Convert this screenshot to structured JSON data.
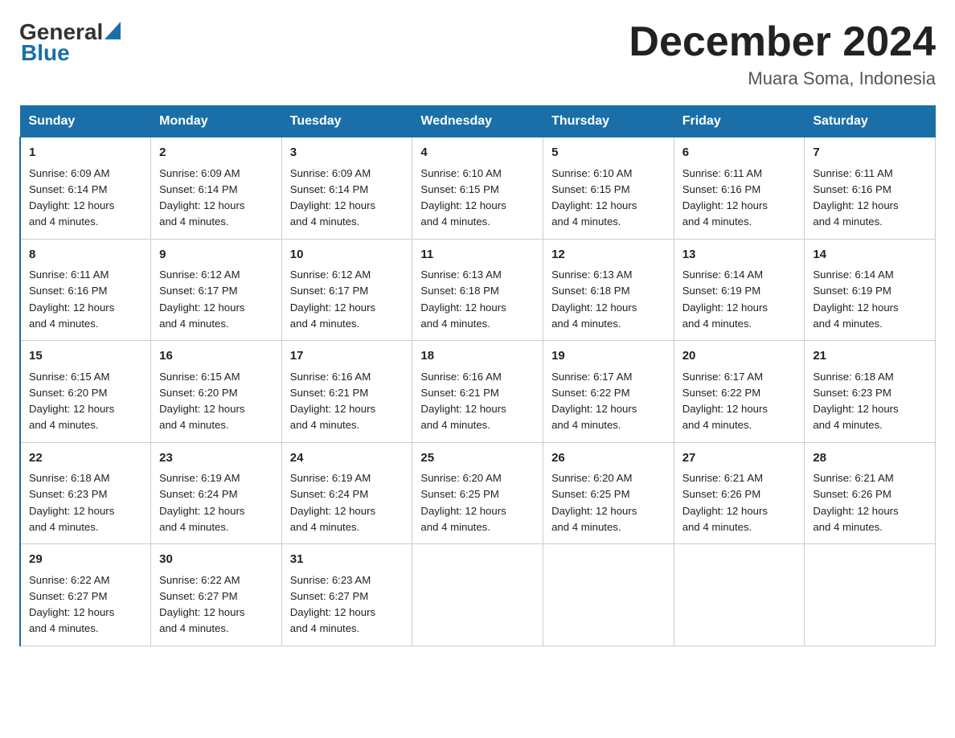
{
  "header": {
    "logo_general": "General",
    "logo_blue": "Blue",
    "title": "December 2024",
    "subtitle": "Muara Soma, Indonesia"
  },
  "days_of_week": [
    "Sunday",
    "Monday",
    "Tuesday",
    "Wednesday",
    "Thursday",
    "Friday",
    "Saturday"
  ],
  "weeks": [
    [
      {
        "day": "1",
        "sunrise": "6:09 AM",
        "sunset": "6:14 PM",
        "daylight": "12 hours and 4 minutes."
      },
      {
        "day": "2",
        "sunrise": "6:09 AM",
        "sunset": "6:14 PM",
        "daylight": "12 hours and 4 minutes."
      },
      {
        "day": "3",
        "sunrise": "6:09 AM",
        "sunset": "6:14 PM",
        "daylight": "12 hours and 4 minutes."
      },
      {
        "day": "4",
        "sunrise": "6:10 AM",
        "sunset": "6:15 PM",
        "daylight": "12 hours and 4 minutes."
      },
      {
        "day": "5",
        "sunrise": "6:10 AM",
        "sunset": "6:15 PM",
        "daylight": "12 hours and 4 minutes."
      },
      {
        "day": "6",
        "sunrise": "6:11 AM",
        "sunset": "6:16 PM",
        "daylight": "12 hours and 4 minutes."
      },
      {
        "day": "7",
        "sunrise": "6:11 AM",
        "sunset": "6:16 PM",
        "daylight": "12 hours and 4 minutes."
      }
    ],
    [
      {
        "day": "8",
        "sunrise": "6:11 AM",
        "sunset": "6:16 PM",
        "daylight": "12 hours and 4 minutes."
      },
      {
        "day": "9",
        "sunrise": "6:12 AM",
        "sunset": "6:17 PM",
        "daylight": "12 hours and 4 minutes."
      },
      {
        "day": "10",
        "sunrise": "6:12 AM",
        "sunset": "6:17 PM",
        "daylight": "12 hours and 4 minutes."
      },
      {
        "day": "11",
        "sunrise": "6:13 AM",
        "sunset": "6:18 PM",
        "daylight": "12 hours and 4 minutes."
      },
      {
        "day": "12",
        "sunrise": "6:13 AM",
        "sunset": "6:18 PM",
        "daylight": "12 hours and 4 minutes."
      },
      {
        "day": "13",
        "sunrise": "6:14 AM",
        "sunset": "6:19 PM",
        "daylight": "12 hours and 4 minutes."
      },
      {
        "day": "14",
        "sunrise": "6:14 AM",
        "sunset": "6:19 PM",
        "daylight": "12 hours and 4 minutes."
      }
    ],
    [
      {
        "day": "15",
        "sunrise": "6:15 AM",
        "sunset": "6:20 PM",
        "daylight": "12 hours and 4 minutes."
      },
      {
        "day": "16",
        "sunrise": "6:15 AM",
        "sunset": "6:20 PM",
        "daylight": "12 hours and 4 minutes."
      },
      {
        "day": "17",
        "sunrise": "6:16 AM",
        "sunset": "6:21 PM",
        "daylight": "12 hours and 4 minutes."
      },
      {
        "day": "18",
        "sunrise": "6:16 AM",
        "sunset": "6:21 PM",
        "daylight": "12 hours and 4 minutes."
      },
      {
        "day": "19",
        "sunrise": "6:17 AM",
        "sunset": "6:22 PM",
        "daylight": "12 hours and 4 minutes."
      },
      {
        "day": "20",
        "sunrise": "6:17 AM",
        "sunset": "6:22 PM",
        "daylight": "12 hours and 4 minutes."
      },
      {
        "day": "21",
        "sunrise": "6:18 AM",
        "sunset": "6:23 PM",
        "daylight": "12 hours and 4 minutes."
      }
    ],
    [
      {
        "day": "22",
        "sunrise": "6:18 AM",
        "sunset": "6:23 PM",
        "daylight": "12 hours and 4 minutes."
      },
      {
        "day": "23",
        "sunrise": "6:19 AM",
        "sunset": "6:24 PM",
        "daylight": "12 hours and 4 minutes."
      },
      {
        "day": "24",
        "sunrise": "6:19 AM",
        "sunset": "6:24 PM",
        "daylight": "12 hours and 4 minutes."
      },
      {
        "day": "25",
        "sunrise": "6:20 AM",
        "sunset": "6:25 PM",
        "daylight": "12 hours and 4 minutes."
      },
      {
        "day": "26",
        "sunrise": "6:20 AM",
        "sunset": "6:25 PM",
        "daylight": "12 hours and 4 minutes."
      },
      {
        "day": "27",
        "sunrise": "6:21 AM",
        "sunset": "6:26 PM",
        "daylight": "12 hours and 4 minutes."
      },
      {
        "day": "28",
        "sunrise": "6:21 AM",
        "sunset": "6:26 PM",
        "daylight": "12 hours and 4 minutes."
      }
    ],
    [
      {
        "day": "29",
        "sunrise": "6:22 AM",
        "sunset": "6:27 PM",
        "daylight": "12 hours and 4 minutes."
      },
      {
        "day": "30",
        "sunrise": "6:22 AM",
        "sunset": "6:27 PM",
        "daylight": "12 hours and 4 minutes."
      },
      {
        "day": "31",
        "sunrise": "6:23 AM",
        "sunset": "6:27 PM",
        "daylight": "12 hours and 4 minutes."
      },
      null,
      null,
      null,
      null
    ]
  ],
  "sunrise_label": "Sunrise:",
  "sunset_label": "Sunset:",
  "daylight_label": "Daylight:"
}
